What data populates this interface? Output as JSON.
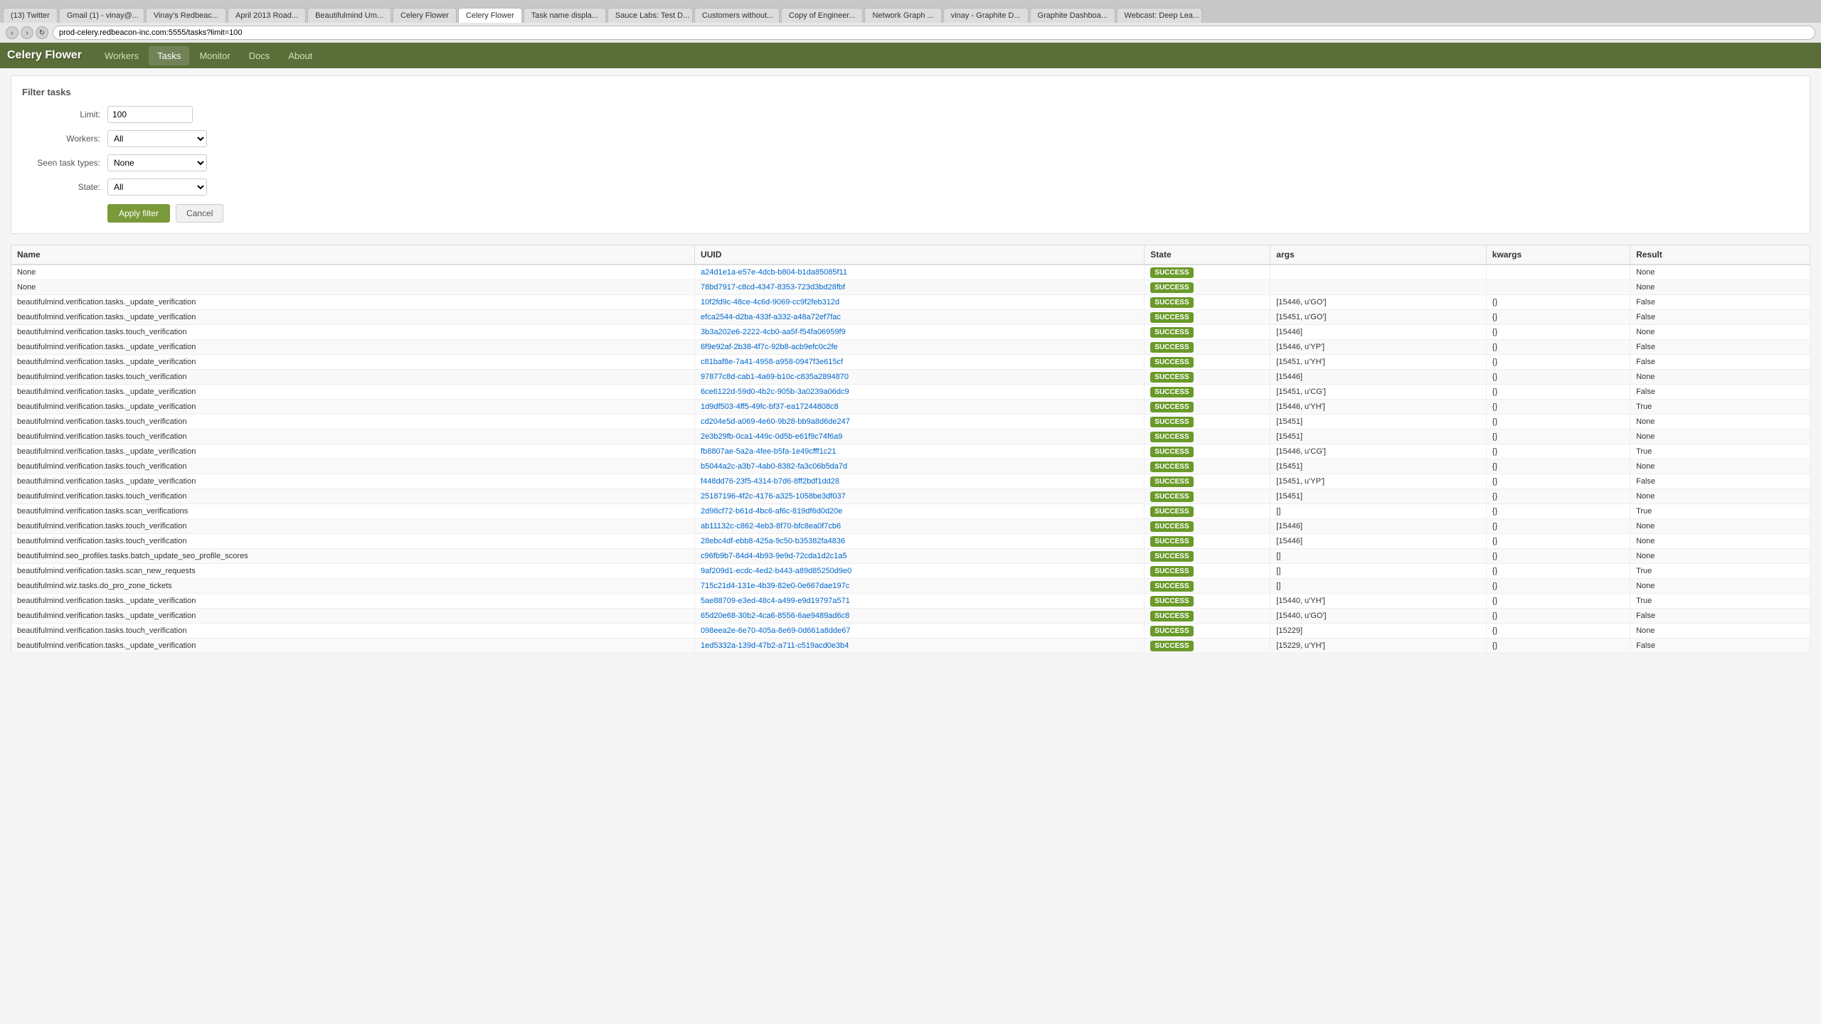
{
  "browser": {
    "tabs": [
      {
        "label": "(13) Twitter",
        "active": false
      },
      {
        "label": "Gmail (1) - vinay@...",
        "active": false
      },
      {
        "label": "Vinay's Redbeac...",
        "active": false
      },
      {
        "label": "April 2013 Road...",
        "active": false
      },
      {
        "label": "Beautifulmind Um...",
        "active": false
      },
      {
        "label": "Celery Flower",
        "active": false
      },
      {
        "label": "Celery Flower",
        "active": true
      },
      {
        "label": "Task name displa...",
        "active": false
      },
      {
        "label": "Sauce Labs: Test D...",
        "active": false
      },
      {
        "label": "Customers without...",
        "active": false
      },
      {
        "label": "Copy of Engineer...",
        "active": false
      },
      {
        "label": "Network Graph ...",
        "active": false
      },
      {
        "label": "vinay - Graphite D...",
        "active": false
      },
      {
        "label": "Graphite Dashboa...",
        "active": false
      },
      {
        "label": "Webcast: Deep Lea...",
        "active": false
      }
    ],
    "url": "prod-celery.redbeacon-inc.com:5555/tasks?limit=100"
  },
  "app": {
    "logo": "Celery Flower",
    "nav": [
      {
        "label": "Workers",
        "active": false
      },
      {
        "label": "Tasks",
        "active": true
      },
      {
        "label": "Monitor",
        "active": false
      },
      {
        "label": "Docs",
        "active": false
      },
      {
        "label": "About",
        "active": false
      }
    ]
  },
  "filter": {
    "title": "Filter tasks",
    "limit_label": "Limit:",
    "limit_value": "100",
    "workers_label": "Workers:",
    "workers_value": "All",
    "seen_types_label": "Seen task types:",
    "seen_types_value": "None",
    "state_label": "State:",
    "state_value": "All",
    "apply_label": "Apply filter",
    "cancel_label": "Cancel"
  },
  "table": {
    "columns": [
      "Name",
      "UUID",
      "State",
      "args",
      "kwargs",
      "Result"
    ],
    "rows": [
      {
        "name": "None",
        "uuid": "a24d1e1a-e57e-4dcb-b804-b1da85085f11",
        "state": "SUCCESS",
        "args": "",
        "kwargs": "",
        "result": "None"
      },
      {
        "name": "None",
        "uuid": "78bd7917-c8cd-4347-8353-723d3bd28fbf",
        "state": "SUCCESS",
        "args": "",
        "kwargs": "",
        "result": "None"
      },
      {
        "name": "beautifulmind.verification.tasks._update_verification",
        "uuid": "10f2fd9c-48ce-4c6d-9069-cc9f2feb312d",
        "state": "SUCCESS",
        "args": "[15446, u'GO']",
        "kwargs": "{}",
        "result": "False"
      },
      {
        "name": "beautifulmind.verification.tasks._update_verification",
        "uuid": "efca2544-d2ba-433f-a332-a48a72ef7fac",
        "state": "SUCCESS",
        "args": "[15451, u'GO']",
        "kwargs": "{}",
        "result": "False"
      },
      {
        "name": "beautifulmind.verification.tasks.touch_verification",
        "uuid": "3b3a202e6-2222-4cb0-aa5f-f54fa06959f9",
        "state": "SUCCESS",
        "args": "[15446]",
        "kwargs": "{}",
        "result": "None"
      },
      {
        "name": "beautifulmind.verification.tasks._update_verification",
        "uuid": "6f9e92af-2b38-4f7c-92b8-acb9efc0c2fe",
        "state": "SUCCESS",
        "args": "[15446, u'YP']",
        "kwargs": "{}",
        "result": "False"
      },
      {
        "name": "beautifulmind.verification.tasks._update_verification",
        "uuid": "c81baf8e-7a41-4958-a958-0947f3e615cf",
        "state": "SUCCESS",
        "args": "[15451, u'YH']",
        "kwargs": "{}",
        "result": "False"
      },
      {
        "name": "beautifulmind.verification.tasks.touch_verification",
        "uuid": "97877c8d-cab1-4a69-b10c-c835a2894870",
        "state": "SUCCESS",
        "args": "[15446]",
        "kwargs": "{}",
        "result": "None"
      },
      {
        "name": "beautifulmind.verification.tasks._update_verification",
        "uuid": "6ce6122d-59d0-4b2c-905b-3a0239a06dc9",
        "state": "SUCCESS",
        "args": "[15451, u'CG']",
        "kwargs": "{}",
        "result": "False"
      },
      {
        "name": "beautifulmind.verification.tasks._update_verification",
        "uuid": "1d9df503-4ff5-49fc-bf37-ea17244808c8",
        "state": "SUCCESS",
        "args": "[15446, u'YH']",
        "kwargs": "{}",
        "result": "True"
      },
      {
        "name": "beautifulmind.verification.tasks.touch_verification",
        "uuid": "cd204e5d-a069-4e60-9b28-bb9a8d6de247",
        "state": "SUCCESS",
        "args": "[15451]",
        "kwargs": "{}",
        "result": "None"
      },
      {
        "name": "beautifulmind.verification.tasks.touch_verification",
        "uuid": "2e3b29fb-0ca1-449c-0d5b-e61f9c74f6a9",
        "state": "SUCCESS",
        "args": "[15451]",
        "kwargs": "{}",
        "result": "None"
      },
      {
        "name": "beautifulmind.verification.tasks._update_verification",
        "uuid": "fb8807ae-5a2a-4fee-b5fa-1e49cfff1c21",
        "state": "SUCCESS",
        "args": "[15446, u'CG']",
        "kwargs": "{}",
        "result": "True"
      },
      {
        "name": "beautifulmind.verification.tasks.touch_verification",
        "uuid": "b5044a2c-a3b7-4ab0-8382-fa3c06b5da7d",
        "state": "SUCCESS",
        "args": "[15451]",
        "kwargs": "{}",
        "result": "None"
      },
      {
        "name": "beautifulmind.verification.tasks._update_verification",
        "uuid": "f448dd76-23f5-4314-b7d6-8ff2bdf1dd28",
        "state": "SUCCESS",
        "args": "[15451, u'YP']",
        "kwargs": "{}",
        "result": "False"
      },
      {
        "name": "beautifulmind.verification.tasks.touch_verification",
        "uuid": "25187196-4f2c-4176-a325-1058be3df037",
        "state": "SUCCESS",
        "args": "[15451]",
        "kwargs": "{}",
        "result": "None"
      },
      {
        "name": "beautifulmind.verification.tasks.scan_verifications",
        "uuid": "2d98cf72-b61d-4bc6-af6c-819df6d0d20e",
        "state": "SUCCESS",
        "args": "[]",
        "kwargs": "{}",
        "result": "True"
      },
      {
        "name": "beautifulmind.verification.tasks.touch_verification",
        "uuid": "ab11132c-c862-4eb3-8f70-bfc8ea0f7cb6",
        "state": "SUCCESS",
        "args": "[15446]",
        "kwargs": "{}",
        "result": "None"
      },
      {
        "name": "beautifulmind.verification.tasks.touch_verification",
        "uuid": "28ebc4df-ebb8-425a-9c50-b35382fa4836",
        "state": "SUCCESS",
        "args": "[15446]",
        "kwargs": "{}",
        "result": "None"
      },
      {
        "name": "beautifulmind.seo_profiles.tasks.batch_update_seo_profile_scores",
        "uuid": "c96fb9b7-84d4-4b93-9e9d-72cda1d2c1a5",
        "state": "SUCCESS",
        "args": "[]",
        "kwargs": "{}",
        "result": "None"
      },
      {
        "name": "beautifulmind.verification.tasks.scan_new_requests",
        "uuid": "9af209d1-ecdc-4ed2-b443-a89d85250d9e0",
        "state": "SUCCESS",
        "args": "[]",
        "kwargs": "{}",
        "result": "True"
      },
      {
        "name": "beautifulmind.wiz.tasks.do_pro_zone_tickets",
        "uuid": "715c21d4-131e-4b39-82e0-0e667dae197c",
        "state": "SUCCESS",
        "args": "[]",
        "kwargs": "{}",
        "result": "None"
      },
      {
        "name": "beautifulmind.verification.tasks._update_verification",
        "uuid": "5ae88709-e3ed-48c4-a499-e9d19797a571",
        "state": "SUCCESS",
        "args": "[15440, u'YH']",
        "kwargs": "{}",
        "result": "True"
      },
      {
        "name": "beautifulmind.verification.tasks._update_verification",
        "uuid": "65d20e68-30b2-4ca6-8556-6ae9489ad6c8",
        "state": "SUCCESS",
        "args": "[15440, u'GO']",
        "kwargs": "{}",
        "result": "False"
      },
      {
        "name": "beautifulmind.verification.tasks.touch_verification",
        "uuid": "098eea2e-6e70-405a-8e69-0d661a8dde67",
        "state": "SUCCESS",
        "args": "[15229]",
        "kwargs": "{}",
        "result": "None"
      },
      {
        "name": "beautifulmind.verification.tasks._update_verification",
        "uuid": "1ed5332a-139d-47b2-a711-c519acd0e3b4",
        "state": "SUCCESS",
        "args": "[15229, u'YH']",
        "kwargs": "{}",
        "result": "False"
      }
    ]
  }
}
